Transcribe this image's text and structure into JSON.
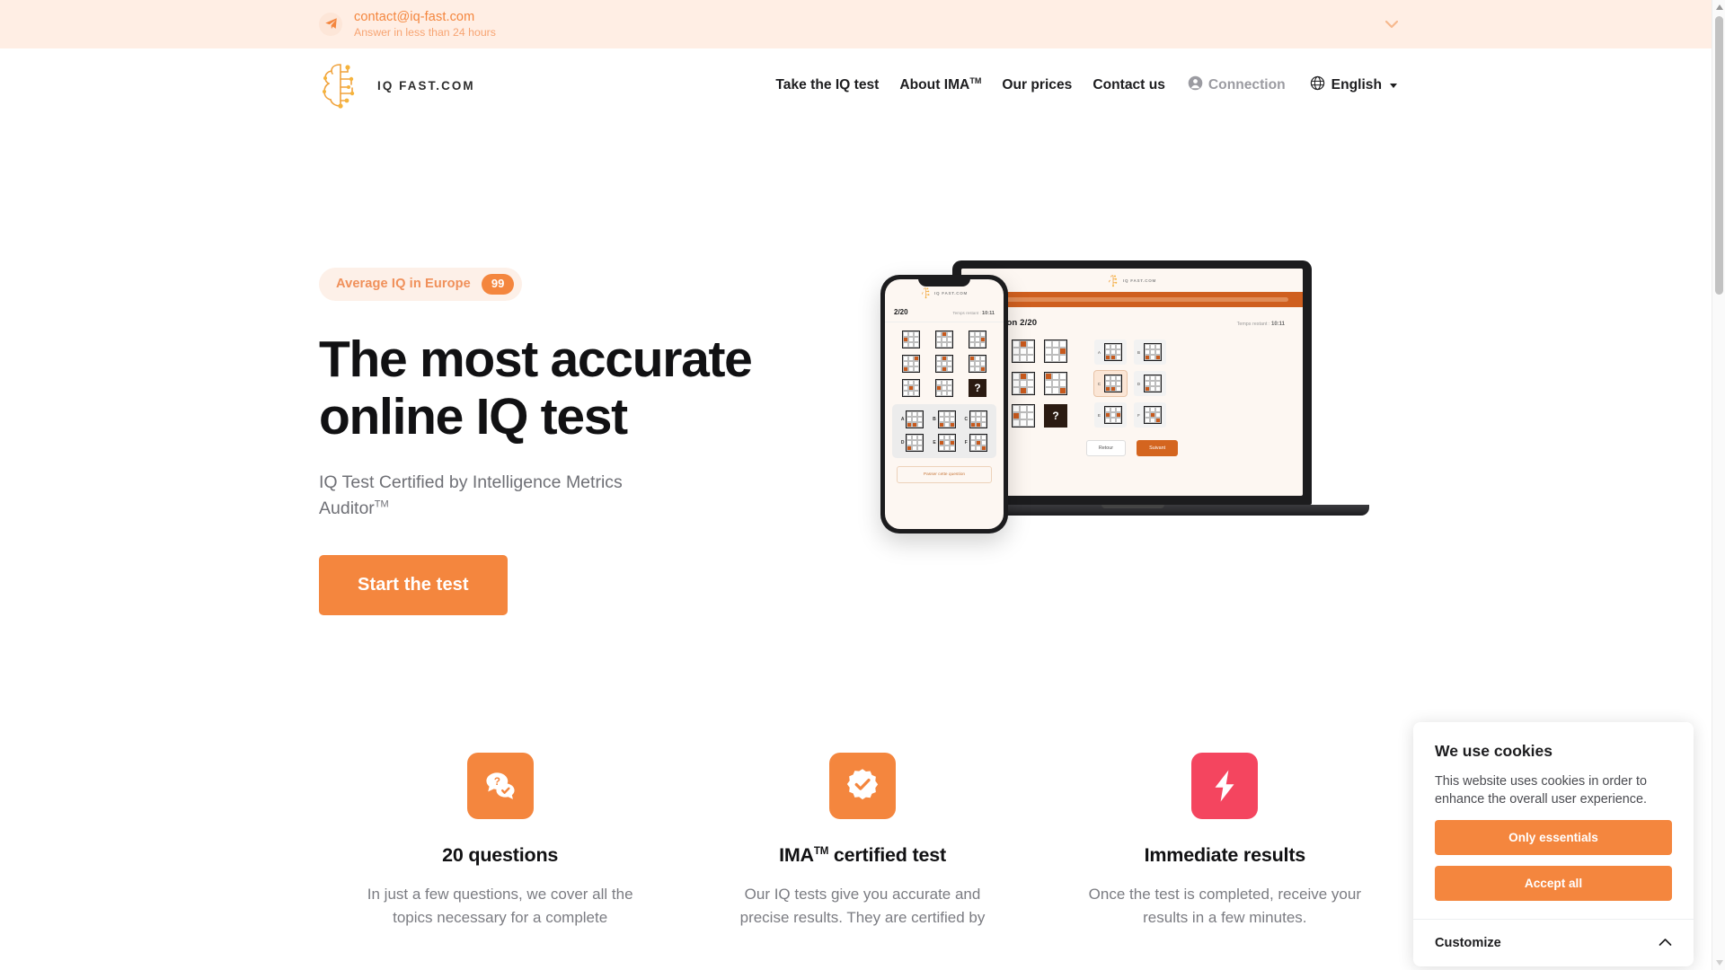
{
  "topbar": {
    "email": "contact@iq-fast.com",
    "subtext": "Answer in less than 24 hours",
    "icon": "paper-plane-icon",
    "chevron_icon": "chevron-down-icon"
  },
  "header": {
    "brand_name": "IQ FAST.COM",
    "logo_icon": "brain-circuit-logo",
    "nav": [
      {
        "label": "Take the IQ test"
      },
      {
        "label": "About IMA",
        "sup": "TM"
      },
      {
        "label": "Our prices"
      },
      {
        "label": "Contact us"
      }
    ],
    "account": {
      "label": "Connection",
      "icon": "user-circle-icon"
    },
    "language": {
      "label": "English",
      "icon": "globe-icon",
      "caret": "caret-down-icon"
    }
  },
  "hero": {
    "badge_label": "Average IQ in Europe",
    "badge_value": "99",
    "title": "The most accurate online IQ test",
    "subtitle": "IQ Test Certified by Intelligence Metrics Auditor",
    "subtitle_sup": "TM",
    "cta_label": "Start the test",
    "mockup": {
      "laptop": {
        "brand": "IQ FAST.COM",
        "question_label": "Question 2/20",
        "timer_label": "Temps restant :",
        "timer_value": "10:11",
        "option_letters": [
          "A",
          "B",
          "C",
          "D",
          "E",
          "F"
        ],
        "selected_option": "C",
        "question_mark": "?",
        "refuse_label": "Retour",
        "submit_label": "Suivant"
      },
      "phone": {
        "brand": "IQ FAST.COM",
        "progress_label": "2/20",
        "timer_label": "Temps restant :",
        "timer_value": "10:11",
        "option_letters": [
          "A",
          "B",
          "C",
          "D",
          "E",
          "F"
        ],
        "question_mark": "?",
        "skip_label": "Passer cette question"
      }
    }
  },
  "features": [
    {
      "icon": "chat-question-icon",
      "icon_color": "#f4863e",
      "title": "20 questions",
      "title_sup": "",
      "desc": "In just a few questions, we cover all the topics necessary for a complete"
    },
    {
      "icon": "certified-badge-icon",
      "icon_color": "#f4863e",
      "title": "IMA",
      "title_sup": "TM",
      "title_rest": " certified test",
      "desc": "Our IQ tests give you accurate and precise results. They are certified by"
    },
    {
      "icon": "lightning-bolt-icon",
      "icon_color": "#f4455f",
      "title": "Immediate results",
      "title_sup": "",
      "desc": "Once the test is completed, receive your results in a few minutes."
    }
  ],
  "cookies": {
    "title": "We use cookies",
    "text": "This website uses cookies in order to enhance the overall user experience.",
    "only_essentials_label": "Only essentials",
    "accept_all_label": "Accept all",
    "customize_label": "Customize",
    "customize_icon": "chevron-up-icon"
  },
  "colors": {
    "accent": "#f4863e",
    "accent_soft": "#ffeee4",
    "danger": "#f4455f",
    "text": "#111113",
    "muted": "#7b7c82"
  },
  "scrollbar": {
    "up_icon": "scroll-up-arrow",
    "down_icon": "scroll-down-arrow"
  }
}
